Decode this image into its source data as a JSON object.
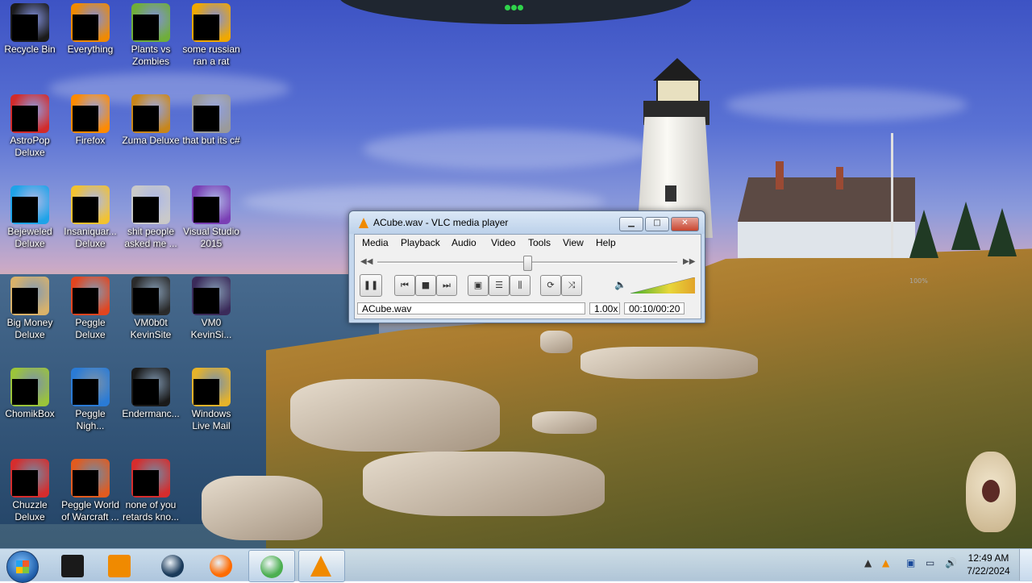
{
  "desktop": {
    "icons": [
      {
        "label": "Recycle Bin",
        "icon": "recycle-bin-icon",
        "color": "#1b1b1b"
      },
      {
        "label": "Everything",
        "icon": "everything-search-icon",
        "color": "#f08a00"
      },
      {
        "label": "Plants vs Zombies",
        "icon": "plants-vs-zombies-icon",
        "color": "#6fae3a"
      },
      {
        "label": "some russian ran a rat",
        "icon": "java-installer-icon",
        "color": "#f0a800"
      },
      {
        "label": "AstroPop Deluxe",
        "icon": "astropop-icon",
        "color": "#d22b2b"
      },
      {
        "label": "Firefox",
        "icon": "firefox-icon",
        "color": "#ff8a00"
      },
      {
        "label": "Zuma Deluxe",
        "icon": "zuma-icon",
        "color": "#c8861a"
      },
      {
        "label": "that but its c#",
        "icon": "shortcut-stack-icon",
        "color": "#9a9a9a"
      },
      {
        "label": "Bejeweled Deluxe",
        "icon": "bejeweled-icon",
        "color": "#1fa3e8"
      },
      {
        "label": "Insaniquar... Deluxe",
        "icon": "insaniquarium-icon",
        "color": "#f2c230"
      },
      {
        "label": "shit people asked me ...",
        "icon": "document-icon",
        "color": "#c9c9c9"
      },
      {
        "label": "Visual Studio 2015",
        "icon": "visual-studio-icon",
        "color": "#7a3fb5"
      },
      {
        "label": "Big Money Deluxe",
        "icon": "big-money-icon",
        "color": "#d9b26a"
      },
      {
        "label": "Peggle Deluxe",
        "icon": "peggle-icon",
        "color": "#e2451f"
      },
      {
        "label": "VM0b0t KevinSite",
        "icon": "terminal-icon",
        "color": "#2b2b2b"
      },
      {
        "label": "VM0 KevinSi...",
        "icon": "vm-icon",
        "color": "#3b2b5a"
      },
      {
        "label": "ChomikBox",
        "icon": "chomikbox-icon",
        "color": "#9bc43a"
      },
      {
        "label": "Peggle Nigh...",
        "icon": "peggle-nights-icon",
        "color": "#2a7bd6"
      },
      {
        "label": "Endermanc...",
        "icon": "console-icon",
        "color": "#1a1a1a"
      },
      {
        "label": "Windows Live Mail",
        "icon": "windows-live-mail-icon",
        "color": "#e6b32a"
      },
      {
        "label": "Chuzzle Deluxe",
        "icon": "chuzzle-icon",
        "color": "#d62d2d"
      },
      {
        "label": "Peggle World of Warcraft ...",
        "icon": "peggle-wow-icon",
        "color": "#e25b1f"
      },
      {
        "label": "none of you retards kno...",
        "icon": "red-swirl-icon",
        "color": "#d62d2d"
      }
    ]
  },
  "vlc": {
    "title": "ACube.wav - VLC media player",
    "caption_buttons": {
      "minimize": "▁",
      "maximize": "□",
      "close": "✕"
    },
    "menu": [
      "Media",
      "Playback",
      "Audio",
      "Video",
      "Tools",
      "View",
      "Help"
    ],
    "seek": {
      "back_glyph": "◀◀",
      "forward_glyph": "▶▶",
      "position": 0.5
    },
    "controls": {
      "pause": "❚❚",
      "prev": "⏮",
      "stop": "■",
      "next": "⏭",
      "fullscreen": "▣",
      "playlist": "☰",
      "extended": "⫼",
      "loop": "⟳",
      "shuffle": "⤨"
    },
    "volume": {
      "glyph": "🔈",
      "level_text": "100%",
      "level": 1.0
    },
    "status": {
      "filename": "ACube.wav",
      "speed": "1.00x",
      "time": "00:10/00:20"
    }
  },
  "taskbar": {
    "pinned": [
      {
        "name": "taskbar-terminal",
        "icon": "black-box-icon",
        "color": "#1a1a1a"
      },
      {
        "name": "taskbar-media-player",
        "icon": "media-player-icon",
        "color": "#f08a00"
      },
      {
        "name": "taskbar-globe",
        "icon": "globe-icon",
        "color": "#1a3a5a"
      },
      {
        "name": "taskbar-firefox",
        "icon": "firefox-icon",
        "color": "#ff6b00"
      },
      {
        "name": "taskbar-chrome",
        "icon": "chrome-icon",
        "color": "#4caf50"
      },
      {
        "name": "taskbar-vlc",
        "icon": "vlc-icon",
        "color": "#f08a00"
      }
    ],
    "tray": {
      "show_hidden": "▲",
      "vlc": "▲",
      "network": "▣",
      "monitor": "▭",
      "sound": "🔊"
    },
    "clock": {
      "time": "12:49 AM",
      "date": "7/22/2024"
    }
  }
}
